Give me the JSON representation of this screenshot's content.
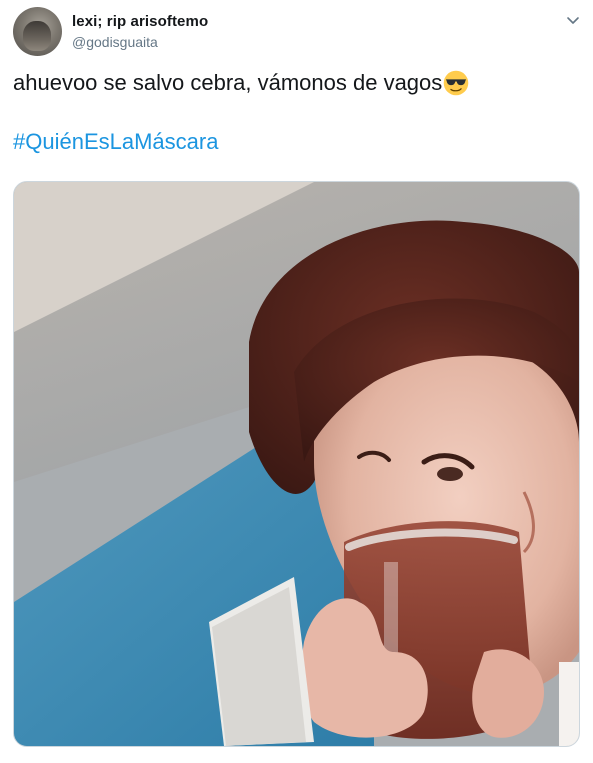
{
  "user": {
    "display_name": "lexi; rip arisoftemo",
    "handle": "@godisguaita",
    "avatar_icon": "profile-photo"
  },
  "tweet": {
    "text": "ahuevoo se salvo cebra, vámonos de vagos",
    "emoji": "smiling-face-with-sunglasses",
    "hashtag": "#QuiénEsLaMáscara",
    "media_description_icon": "photo"
  },
  "colors": {
    "text": "#14171a",
    "secondary": "#657786",
    "link": "#1b95e0",
    "border": "#ccd6dd"
  },
  "menu": {
    "icon": "chevron-down-icon"
  }
}
